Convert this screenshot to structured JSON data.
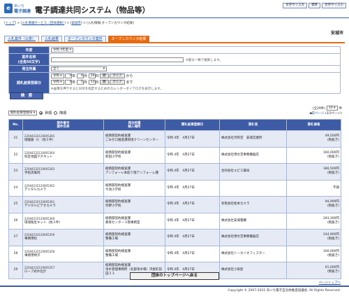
{
  "header": {
    "logo_line1": "あいち",
    "logo_line2": "電子調達",
    "title": "電子調達共同システム（物品等）",
    "buttons": [
      "文字サイズ大",
      "標準",
      "文字サイズ小"
    ]
  },
  "breadcrumb": [
    "トップ",
    "入札情報サービス（団体選択）",
    "安城市",
    "入札情報:オープンカウンタ結果"
  ],
  "city": "安城市",
  "tabs": [
    "入札案件（公表）",
    "入札結果",
    "オープンカウンタ案件",
    "オープンカウンタ結果"
  ],
  "form": {
    "year_label": "年度",
    "year_value": "令和 4年度",
    "name_label": "案件名称",
    "name_sublabel": "(全角50文字)",
    "name_note": "※部分一致で検索します。",
    "section_label": "発注所属",
    "section_value": "全て",
    "date_label": "開札結果登録日",
    "era": "令和",
    "from": {
      "y": "4",
      "m": "4",
      "d": "26"
    },
    "to": {
      "y": "4",
      "m": "5",
      "d": "13"
    },
    "unit_year": "年",
    "unit_month": "月",
    "unit_day": "日",
    "cal_label": "暦",
    "clear_label": "クリア",
    "from_suffix": "から",
    "to_suffix": "まで",
    "date_note": "※画像を押下すると日付を指定するためのカレンダーダイアログを表示します。",
    "search_button": "検　索"
  },
  "sort": {
    "select_value": "開札結果登録日",
    "asc": "昇順",
    "desc": "降順"
  },
  "count": {
    "text": "(全29件)",
    "per_page": "10",
    "suffix": "件"
  },
  "pager": {
    "prev": "前ページ",
    "range": "(3/3ページ)"
  },
  "table": {
    "headers": {
      "no": "No.",
      "case": "案件番号\n案件名称",
      "section": "発注所属\n納入場所",
      "date": "開札結果登録日",
      "winner": "落札者",
      "amount": "落札価格"
    },
    "rows": [
      {
        "no": "21",
        "num": "22044232120005365",
        "name": "硝酸銀（Ⅰ）（他３件）",
        "section": "総務部契約検査課",
        "place": "ごみゼロ推進課環境クリーンセンター",
        "date": "令和 4年　4月27日",
        "winner": "株式会社河和堂　安城営業所",
        "amount": "49,500円",
        "tax": "(税抜き)"
      },
      {
        "no": "22",
        "num": "22044232120005364",
        "name": "校区地図マグネット",
        "section": "総務部契約検査課",
        "place": "新田小学校",
        "date": "令和 4年　4月27日",
        "winner": "株式会社博文堂事務機器店",
        "amount": "160,000円",
        "tax": "(税抜き)"
      },
      {
        "no": "23",
        "num": "22044232120005363",
        "name": "手指消毒剤",
        "section": "総務部契約検査課",
        "place": "アンフォーレ本館５階アンフォーレ課",
        "date": "令和 4年　4月27日",
        "winner": "合同会社エピス薬局",
        "amount": "180,500円",
        "tax": "(税抜き)"
      },
      {
        "no": "24",
        "num": "22044232120005362",
        "name": "デジタルカメラ",
        "section": "総務部契約検査課",
        "place": "今池小学校",
        "date": "令和 4年　4月27日",
        "winner": "",
        "amount": "不調",
        "tax": ""
      },
      {
        "no": "25",
        "num": "22044232120005361",
        "name": "デジタルビデオカメラ",
        "section": "総務部契約検査課",
        "place": "作野小学校",
        "date": "令和 4年　4月27日",
        "winner": "有限会社松本カメラ",
        "amount": "94,999円",
        "tax": "(税抜き)"
      },
      {
        "no": "26",
        "num": "22044232120005360",
        "name": "環境衛生キット（他３件）",
        "section": "総務部契約検査課",
        "place": "教育センター３階事務室",
        "date": "令和 4年　4月27日",
        "winner": "株式会社安城電機",
        "amount": "393,300円",
        "tax": "(税抜き)"
      },
      {
        "no": "27",
        "num": "22044232120005359",
        "name": "事務用机",
        "section": "総務部契約検査課",
        "place": "整備工場",
        "date": "令和 4年　4月27日",
        "winner": "株式会社博文堂事務機器店",
        "amount": "144,900円",
        "tax": "(税抜き)"
      },
      {
        "no": "28",
        "num": "22044232120005358",
        "name": "事務用椅子",
        "section": "総務部契約検査課",
        "place": "整備工場",
        "date": "令和 4年　4月27日",
        "winner": "株式会社トーカイオフィスター",
        "amount": "160,000円",
        "tax": "(税抜き)"
      },
      {
        "no": "29",
        "num": "22044232120005357",
        "name": "ロープ式水位計",
        "section": "総務部契約検査課",
        "place": "浄水管理事務所（北部浄水場）浜屋町前田３３",
        "date": "令和 4年　4月27日",
        "winner": "株式会社小泉屋",
        "amount": "61,000円",
        "tax": "(税抜き)"
      }
    ]
  },
  "back_button": "団体のトップページへ戻る",
  "page_top": "ページトップへ",
  "copyright": "Copyright © 2007-2022 あいち電子自治体推進協議会. All Rights Reserved."
}
